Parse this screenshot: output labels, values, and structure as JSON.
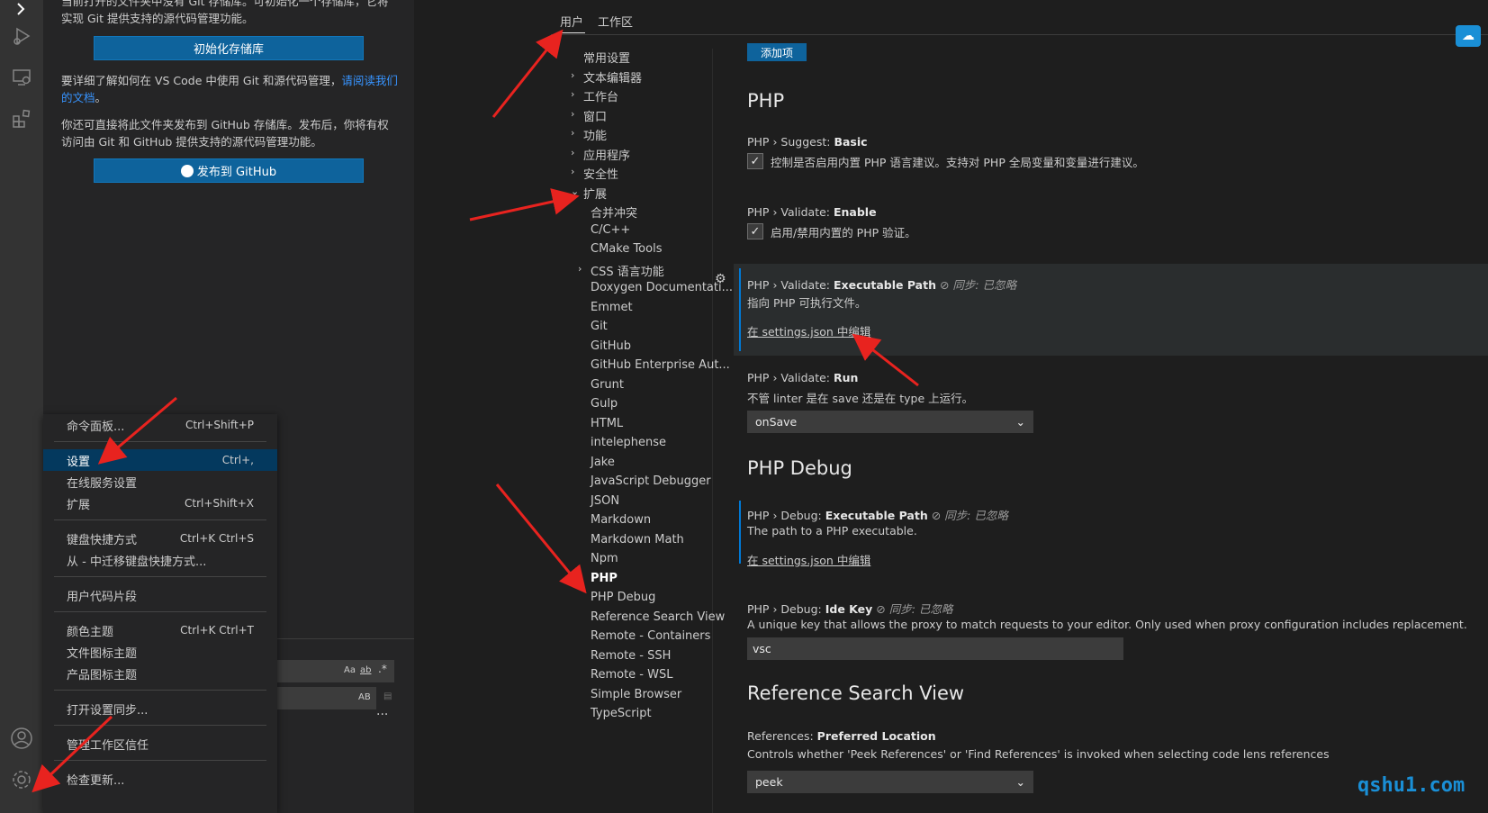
{
  "source_control": {
    "intro_text": "当前打开的文件夹中没有 Git 存储库。可初始化一个存储库，它将实现 Git 提供支持的源代码管理功能。",
    "init_button": "初始化存储库",
    "learn_text": "要详细了解如何在 VS Code 中使用 Git 和源代码管理，",
    "learn_link": "请阅读我们的文档",
    "learn_end": "。",
    "publish_text": "你还可直接将此文件夹发布到 GitHub 存储库。发布后，你将有权访问由 Git 和 GitHub 提供支持的源代码管理功能。",
    "publish_button": "发布到 GitHub"
  },
  "search_widget": {
    "opt_case": "Aa",
    "opt_word": "ab",
    "opt_regex": ".*",
    "opt_preserve": "AB",
    "more": "..."
  },
  "manage_menu": {
    "groups": [
      [
        {
          "label": "命令面板...",
          "key": "Ctrl+Shift+P"
        }
      ],
      [
        {
          "label": "设置",
          "key": "Ctrl+,",
          "selected": true
        },
        {
          "label": "在线服务设置",
          "key": ""
        },
        {
          "label": "扩展",
          "key": "Ctrl+Shift+X"
        }
      ],
      [
        {
          "label": "键盘快捷方式",
          "key": "Ctrl+K Ctrl+S"
        },
        {
          "label": "从 - 中迁移键盘快捷方式...",
          "key": ""
        }
      ],
      [
        {
          "label": "用户代码片段",
          "key": ""
        }
      ],
      [
        {
          "label": "颜色主题",
          "key": "Ctrl+K Ctrl+T"
        },
        {
          "label": "文件图标主题",
          "key": ""
        },
        {
          "label": "产品图标主题",
          "key": ""
        }
      ],
      [
        {
          "label": "打开设置同步...",
          "key": ""
        }
      ],
      [
        {
          "label": "管理工作区信任",
          "key": ""
        }
      ],
      [
        {
          "label": "检查更新...",
          "key": ""
        }
      ]
    ]
  },
  "settings": {
    "tabs": {
      "user": "用户",
      "workspace": "工作区"
    },
    "toc": [
      {
        "label": "常用设置",
        "chevron": false,
        "indent": 0
      },
      {
        "label": "文本编辑器",
        "chevron": true,
        "indent": 0
      },
      {
        "label": "工作台",
        "chevron": true,
        "indent": 0
      },
      {
        "label": "窗口",
        "chevron": true,
        "indent": 0
      },
      {
        "label": "功能",
        "chevron": true,
        "indent": 0
      },
      {
        "label": "应用程序",
        "chevron": true,
        "indent": 0
      },
      {
        "label": "安全性",
        "chevron": true,
        "indent": 0
      },
      {
        "label": "扩展",
        "chevron": true,
        "indent": 0,
        "expanded": true
      },
      {
        "label": "合并冲突",
        "chevron": false,
        "indent": 1
      },
      {
        "label": "C/C++",
        "chevron": false,
        "indent": 1
      },
      {
        "label": "CMake Tools",
        "chevron": false,
        "indent": 1
      },
      {
        "label": "CSS 语言功能",
        "chevron": true,
        "indent": 1
      },
      {
        "label": "Doxygen Documentati...",
        "chevron": false,
        "indent": 1
      },
      {
        "label": "Emmet",
        "chevron": false,
        "indent": 1
      },
      {
        "label": "Git",
        "chevron": false,
        "indent": 1
      },
      {
        "label": "GitHub",
        "chevron": false,
        "indent": 1
      },
      {
        "label": "GitHub Enterprise Aut...",
        "chevron": false,
        "indent": 1
      },
      {
        "label": "Grunt",
        "chevron": false,
        "indent": 1
      },
      {
        "label": "Gulp",
        "chevron": false,
        "indent": 1
      },
      {
        "label": "HTML",
        "chevron": false,
        "indent": 1
      },
      {
        "label": "intelephense",
        "chevron": false,
        "indent": 1
      },
      {
        "label": "Jake",
        "chevron": false,
        "indent": 1
      },
      {
        "label": "JavaScript Debugger",
        "chevron": false,
        "indent": 1
      },
      {
        "label": "JSON",
        "chevron": false,
        "indent": 1
      },
      {
        "label": "Markdown",
        "chevron": false,
        "indent": 1
      },
      {
        "label": "Markdown Math",
        "chevron": false,
        "indent": 1
      },
      {
        "label": "Npm",
        "chevron": false,
        "indent": 1
      },
      {
        "label": "PHP",
        "chevron": false,
        "indent": 1,
        "active": true
      },
      {
        "label": "PHP Debug",
        "chevron": false,
        "indent": 1
      },
      {
        "label": "Reference Search View",
        "chevron": false,
        "indent": 1
      },
      {
        "label": "Remote - Containers",
        "chevron": false,
        "indent": 1
      },
      {
        "label": "Remote - SSH",
        "chevron": false,
        "indent": 1
      },
      {
        "label": "Remote - WSL",
        "chevron": false,
        "indent": 1
      },
      {
        "label": "Simple Browser",
        "chevron": false,
        "indent": 1
      },
      {
        "label": "TypeScript",
        "chevron": false,
        "indent": 1
      }
    ],
    "add_item_button": "添加项",
    "php": {
      "title": "PHP",
      "suggest": {
        "prefix": "PHP › Suggest: ",
        "name": "Basic",
        "desc": "控制是否启用内置 PHP 语言建议。支持对 PHP 全局变量和变量进行建议。",
        "checked": true
      },
      "validate_enable": {
        "prefix": "PHP › Validate: ",
        "name": "Enable",
        "desc": "启用/禁用内置的 PHP 验证。",
        "checked": true
      },
      "validate_path": {
        "prefix": "PHP › Validate: ",
        "name": "Executable Path",
        "sync": "同步: 已忽略",
        "desc": "指向 PHP 可执行文件。",
        "link": "在 settings.json 中编辑"
      },
      "validate_run": {
        "prefix": "PHP › Validate: ",
        "name": "Run",
        "desc": "不管 linter 是在 save 还是在 type 上运行。",
        "value": "onSave"
      }
    },
    "php_debug": {
      "title": "PHP Debug",
      "exec_path": {
        "prefix": "PHP › Debug: ",
        "name": "Executable Path",
        "sync": "同步: 已忽略",
        "desc": "The path to a PHP executable.",
        "link": "在 settings.json 中编辑"
      },
      "ide_key": {
        "prefix": "PHP › Debug: ",
        "name": "Ide Key",
        "sync": "同步: 已忽略",
        "desc": "A unique key that allows the proxy to match requests to your editor. Only used when proxy configuration includes replacement.",
        "value": "vsc"
      }
    },
    "ref_search": {
      "title": "Reference Search View",
      "preferred_location": {
        "prefix": "References: ",
        "name": "Preferred Location",
        "desc": "Controls whether 'Peek References' or 'Find References' is invoked when selecting code lens references",
        "value": "peek"
      }
    }
  },
  "watermark": "qshu1.com",
  "colors": {
    "accent": "#0e639c",
    "focus": "#0078d4",
    "arrow": "#e8231f",
    "watermark": "#1a8fd6"
  }
}
